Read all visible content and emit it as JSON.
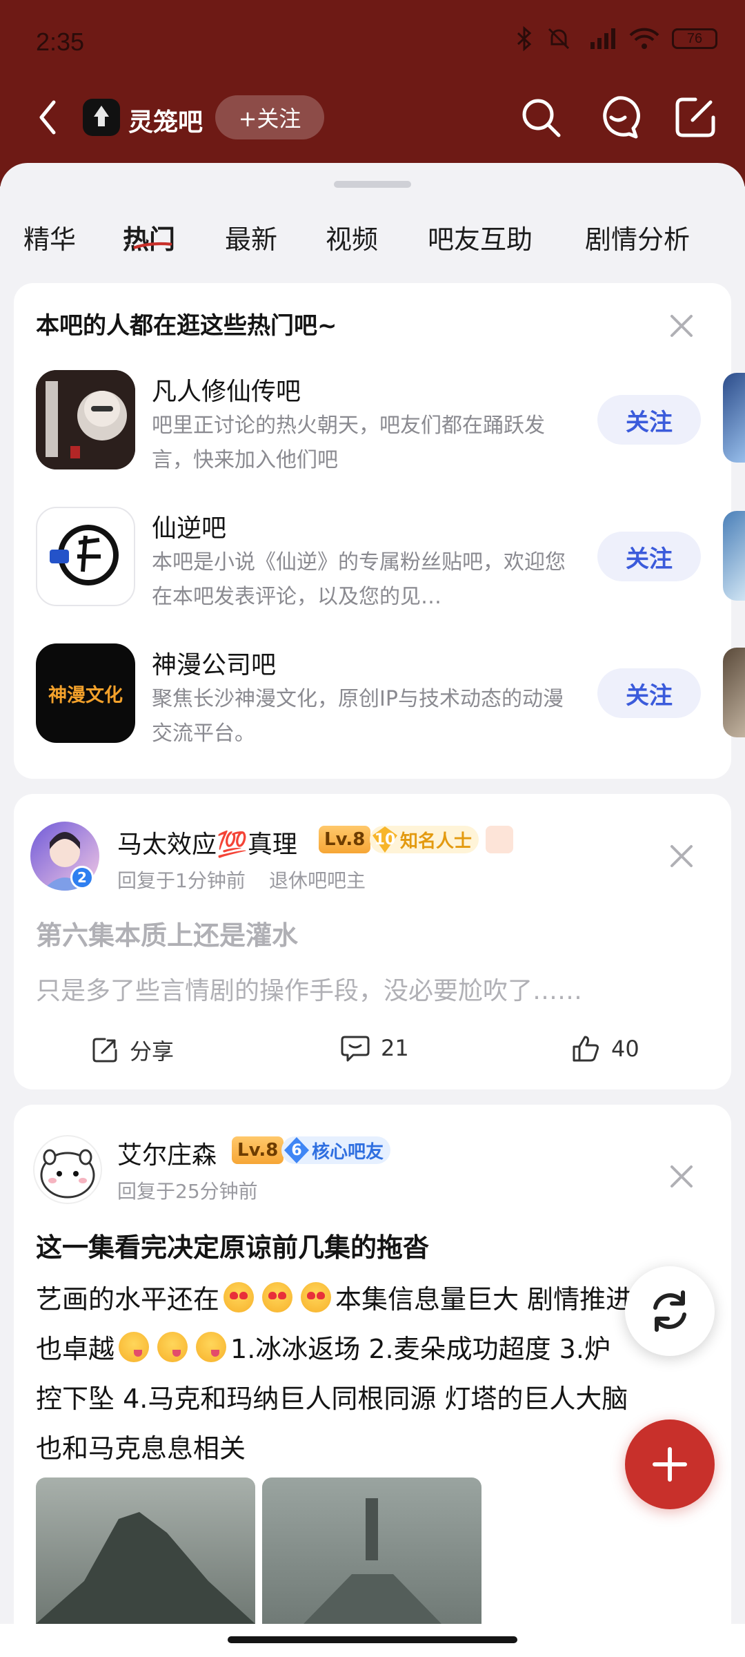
{
  "status_bar": {
    "time": "2:35",
    "battery": "76"
  },
  "header": {
    "forum_name": "灵笼吧",
    "follow_label": "+关注"
  },
  "tabs": [
    "精华",
    "热门",
    "最新",
    "视频",
    "吧友互助",
    "剧情分析"
  ],
  "active_tab": "热门",
  "recommend": {
    "title": "本吧的人都在逛这些热门吧~",
    "items": [
      {
        "name": "凡人修仙传吧",
        "desc": "吧里正讨论的热火朝天，吧友们都在踊跃发言，快来加入他们吧",
        "follow": "关注"
      },
      {
        "name": "仙逆吧",
        "desc": "本吧是小说《仙逆》的专属粉丝贴吧，欢迎您在本吧发表评论，以及您的见…",
        "follow": "关注"
      },
      {
        "name": "神漫公司吧",
        "desc": "聚焦长沙神漫文化，原创IP与技术动态的动漫交流平台。",
        "follow": "关注"
      }
    ],
    "logo_text": "神漫文化"
  },
  "post1": {
    "user": "马太效应💯真理",
    "level": "Lv.8",
    "badge_num": "10",
    "badge_label": "知名人士",
    "avatar_badge": "2",
    "time": "回复于1分钟前",
    "role": "退休吧吧主",
    "title": "第六集本质上还是灌水",
    "body": "只是多了些言情剧的操作手段，没必要尬吹了……",
    "share": "分享",
    "comments": "21",
    "likes": "40"
  },
  "post2": {
    "user": "艾尔庄森",
    "level": "Lv.8",
    "badge_num": "6",
    "badge_label": "核心吧友",
    "time": "回复于25分钟前",
    "title": "这一集看完决定原谅前几集的拖沓",
    "body_line1a": "艺画的水平还在",
    "body_line1b": "本集信息量巨大 剧情推进",
    "body_line2a": "也卓越",
    "body_line2b": "1.冰冰返场 2.麦朵成功超度 3.炉",
    "body_line3": "控下坠 4.马克和玛纳巨人同根同源 灯塔的巨人大脑",
    "body_line4": "也和马克息息相关"
  }
}
